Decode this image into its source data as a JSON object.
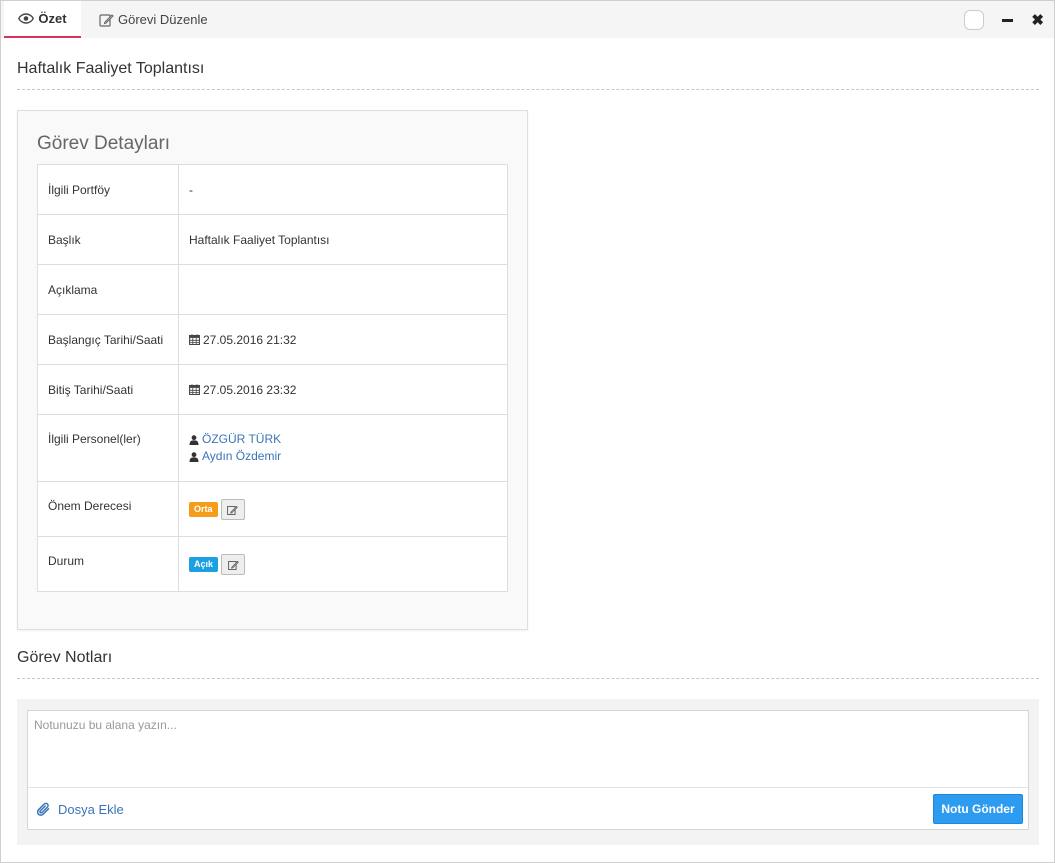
{
  "tabs": [
    {
      "label": "Özet",
      "icon": "eye-icon"
    },
    {
      "label": "Görevi Düzenle",
      "icon": "edit-icon"
    }
  ],
  "page_title": "Haftalık Faaliyet Toplantısı",
  "details": {
    "title": "Görev Detayları",
    "rows": {
      "portfolio": {
        "label": "İlgili Portföy",
        "value": "-"
      },
      "title": {
        "label": "Başlık",
        "value": "Haftalık Faaliyet Toplantısı"
      },
      "description": {
        "label": "Açıklama",
        "value": ""
      },
      "start": {
        "label": "Başlangıç Tarihi/Saati",
        "value": "27.05.2016 21:32"
      },
      "end": {
        "label": "Bitiş Tarihi/Saati",
        "value": "27.05.2016 23:32"
      },
      "personnel": {
        "label": "İlgili Personel(ler)",
        "people": [
          "ÖZGÜR TÜRK",
          "Aydın Özdemir"
        ]
      },
      "priority": {
        "label": "Önem Derecesi",
        "badge": "Orta",
        "color": "#f59c1a"
      },
      "status": {
        "label": "Durum",
        "badge": "Açık",
        "color": "#1ba1e2"
      }
    }
  },
  "notes": {
    "title": "Görev Notları",
    "placeholder": "Notunuzu bu alana yazın...",
    "attach_label": "Dosya Ekle",
    "send_label": "Notu Gönder"
  },
  "colors": {
    "accent_tab": "#d9325d",
    "link": "#3a74b8",
    "primary_button": "#2d9bf0"
  }
}
